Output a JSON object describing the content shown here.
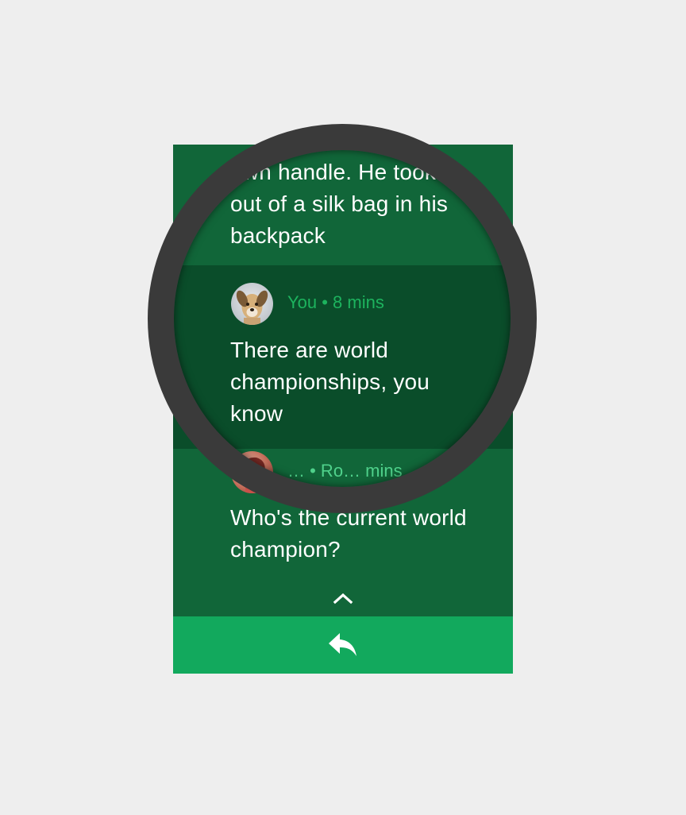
{
  "messages": [
    {
      "sender": "",
      "time": "",
      "text": "own handle. He took\nout of a silk bag in his\nbackpack"
    },
    {
      "sender": "You",
      "time": "8 mins",
      "meta": "You • 8 mins",
      "text": "There are world\nchampionships, you\nknow"
    },
    {
      "meta": "… • Ro… mins",
      "text": "Who's the current world\nchampion?"
    }
  ],
  "actions": {
    "expand_icon": "chevron-up-icon",
    "reply_icon": "reply-icon"
  },
  "colors": {
    "background": "#eeeeee",
    "message_bg": "#116639",
    "selected_message_bg": "#0a4d2a",
    "accent": "#1db35e",
    "reply_bar": "#12a95d",
    "bezel": "#3a3a3a"
  }
}
